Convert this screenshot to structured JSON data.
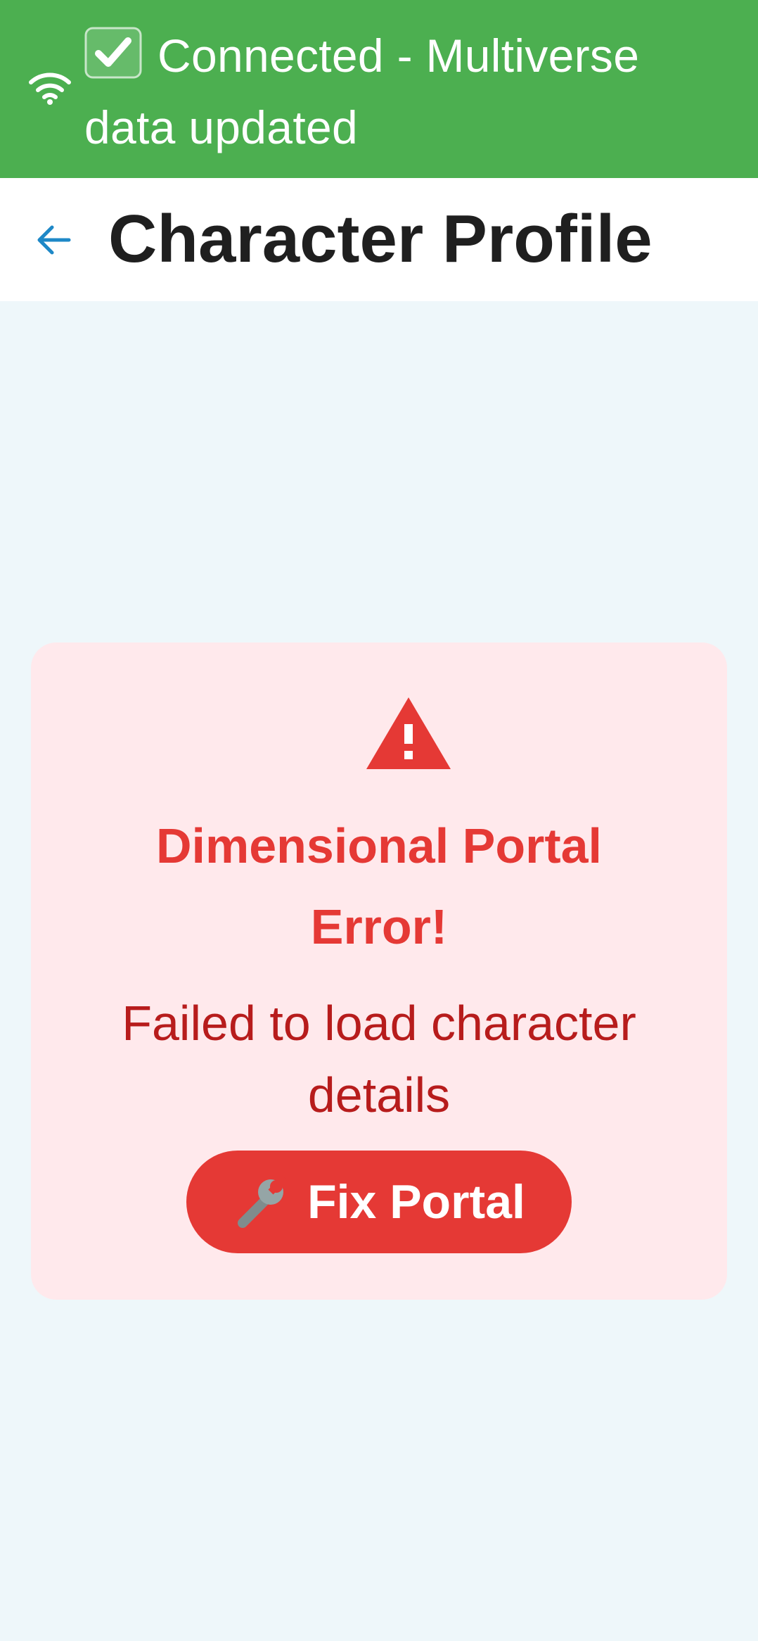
{
  "status_banner": {
    "text": "Connected - Multiverse data updated",
    "icon_wifi": "wifi-icon",
    "icon_check": "check-box-icon",
    "color": "#4caf50"
  },
  "app_bar": {
    "title": "Character Profile",
    "back_icon": "back-arrow-icon"
  },
  "error": {
    "icon": "warning-icon",
    "title": "Dimensional Portal Error!",
    "message": "Failed to load character details",
    "button_label": "Fix Portal",
    "button_icon": "wrench-icon",
    "accent": "#e53935",
    "card_bg": "#ffe9ec"
  }
}
